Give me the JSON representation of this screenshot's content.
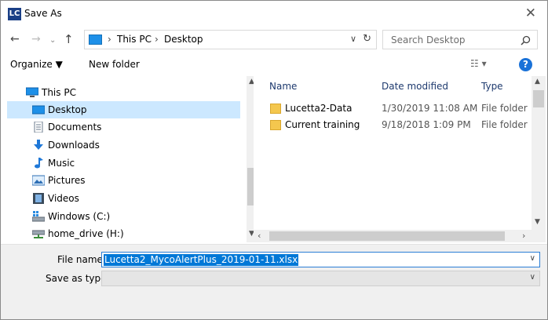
{
  "window": {
    "app_icon_text": "LC",
    "title": "Save As"
  },
  "address": {
    "path": [
      "This PC",
      "Desktop"
    ],
    "search_placeholder": "Search Desktop"
  },
  "toolbar": {
    "organize": "Organize ▼",
    "new_folder": "New folder"
  },
  "nav": {
    "items": [
      {
        "label": "This PC",
        "icon": "computer-icon"
      },
      {
        "label": "Desktop",
        "icon": "desktop-folder-icon",
        "selected": true
      },
      {
        "label": "Documents",
        "icon": "documents-icon"
      },
      {
        "label": "Downloads",
        "icon": "downloads-icon"
      },
      {
        "label": "Music",
        "icon": "music-icon"
      },
      {
        "label": "Pictures",
        "icon": "pictures-icon"
      },
      {
        "label": "Videos",
        "icon": "videos-icon"
      },
      {
        "label": "Windows (C:)",
        "icon": "drive-icon"
      },
      {
        "label": "home_drive  (H:)",
        "icon": "network-drive-icon"
      }
    ]
  },
  "files": {
    "columns": {
      "name": "Name",
      "date": "Date modified",
      "type": "Type"
    },
    "rows": [
      {
        "name": "Lucetta2-Data",
        "date": "1/30/2019 11:08 AM",
        "type": "File folder"
      },
      {
        "name": "Current training",
        "date": "9/18/2018 1:09 PM",
        "type": "File folder"
      }
    ]
  },
  "form": {
    "filename_label": "File name:",
    "filename_value": "Lucetta2_MycoAlertPlus_2019-01-11.xlsx",
    "savetype_label": "Save as type:",
    "savetype_value": ""
  },
  "colors": {
    "accent": "#0078d7",
    "selection": "#cce8ff",
    "folder": "#f4c74e"
  }
}
